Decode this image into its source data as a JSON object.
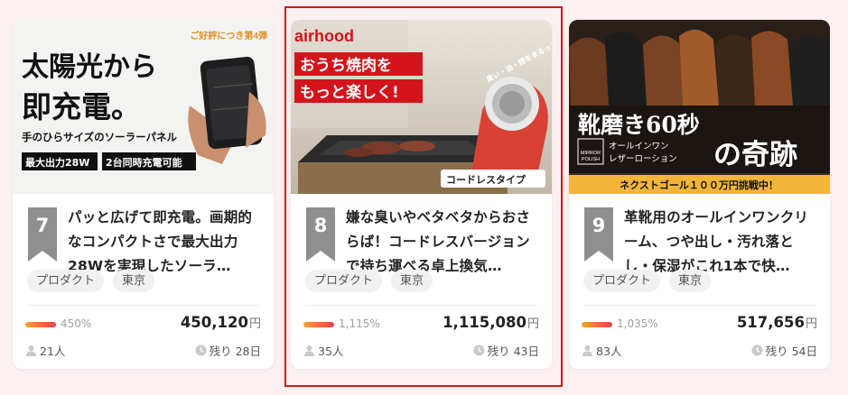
{
  "cards": [
    {
      "rank": "7",
      "title": "パッと広げて即充電。画期的なコンパクトさで最大出力28Wを実現したソーラ…",
      "tags": [
        "プロダクト",
        "東京"
      ],
      "progress_percent": 450,
      "percent_label": "450%",
      "amount": "450,120",
      "currency": "円",
      "supporters": "21人",
      "remaining": "残り 28日",
      "image": {
        "corner_note": "ご好評につき第4弾",
        "headline1": "太陽光から",
        "headline2": "即充電。",
        "subline": "手のひらサイズのソーラーパネル",
        "badge1": "最大出力28W",
        "badge2": "2台同時充電可能"
      }
    },
    {
      "rank": "8",
      "title": "嫌な臭いやベタベタからおさらば！コードレスバージョンで持ち運べる卓上換気…",
      "tags": [
        "プロダクト",
        "東京"
      ],
      "progress_percent": 1115,
      "percent_label": "1,115%",
      "amount": "1,115,080",
      "currency": "円",
      "supporters": "35人",
      "remaining": "残り 43日",
      "image": {
        "brand": "airhood",
        "headline1": "おうち焼肉を",
        "headline2": "もっと楽しく!",
        "device_text": "臭い・油・煙をまるっと吸収",
        "badge": "コードレスタイプ"
      }
    },
    {
      "rank": "9",
      "title": "革靴用のオールインワンクリーム、つや出し・汚れ落とし・保湿がこれ1本で快…",
      "tags": [
        "プロダクト",
        "東京"
      ],
      "progress_percent": 1035,
      "percent_label": "1,035%",
      "amount": "517,656",
      "currency": "円",
      "supporters": "83人",
      "remaining": "残り 54日",
      "image": {
        "headline_a": "靴磨き60秒",
        "headline_b": "の奇跡",
        "logo_top": "MIRROR",
        "logo_bottom": "POLISH",
        "sub1": "オールインワン",
        "sub2": "レザーローション",
        "banner": "ネクストゴール１００万円挑戦中！"
      }
    }
  ],
  "colors": {
    "highlight_border": "#d3141b",
    "progress_start": "#f7a52c",
    "progress_end": "#ee3e4b",
    "rank_ribbon": "#8f8f8f"
  }
}
